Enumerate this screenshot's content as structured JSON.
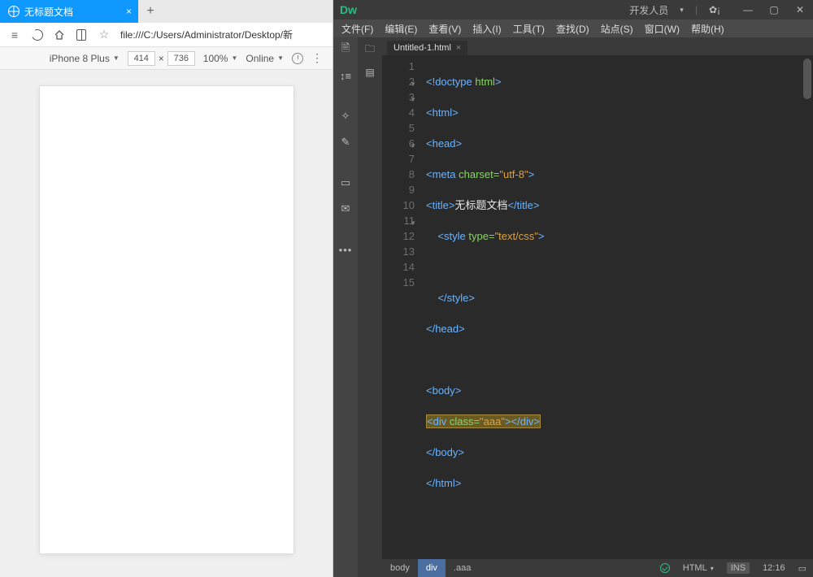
{
  "browser": {
    "tab_title": "无标题文档",
    "url": "file:///C:/Users/Administrator/Desktop/新",
    "device": "iPhone 8 Plus",
    "width": "414",
    "height": "736",
    "zoom": "100%",
    "online": "Online"
  },
  "dw": {
    "logo": "Dw",
    "workspace": "开发人员",
    "menu": [
      "文件(F)",
      "编辑(E)",
      "查看(V)",
      "插入(I)",
      "工具(T)",
      "查找(D)",
      "站点(S)",
      "窗口(W)",
      "帮助(H)"
    ],
    "filetab": "Untitled-1.html",
    "code": {
      "l1": {
        "a": "<!doctype ",
        "b": "html",
        "c": ">"
      },
      "l2": {
        "a": "<html>"
      },
      "l3": {
        "a": "<head>"
      },
      "l4": {
        "a": "<meta ",
        "attr": "charset=",
        "val": "\"utf-8\"",
        "c": ">"
      },
      "l5": {
        "a": "<title>",
        "t": "无标题文档",
        "c": "</title>"
      },
      "l6": {
        "a": "<style ",
        "attr": "type=",
        "val": "\"text/css\"",
        "c": ">"
      },
      "l8": {
        "a": "</style>"
      },
      "l9": {
        "a": "</head>"
      },
      "l11": {
        "a": "<body>"
      },
      "l12": {
        "a": "<div ",
        "attr": "class=",
        "val": "\"aaa\"",
        "c": "></div>"
      },
      "l13": {
        "a": "</body>"
      },
      "l14": {
        "a": "</html>"
      }
    },
    "status": {
      "crumb1": "body",
      "crumb2": "div",
      "crumb3": ".aaa",
      "lang": "HTML",
      "mode": "INS",
      "time": "12:16"
    }
  }
}
